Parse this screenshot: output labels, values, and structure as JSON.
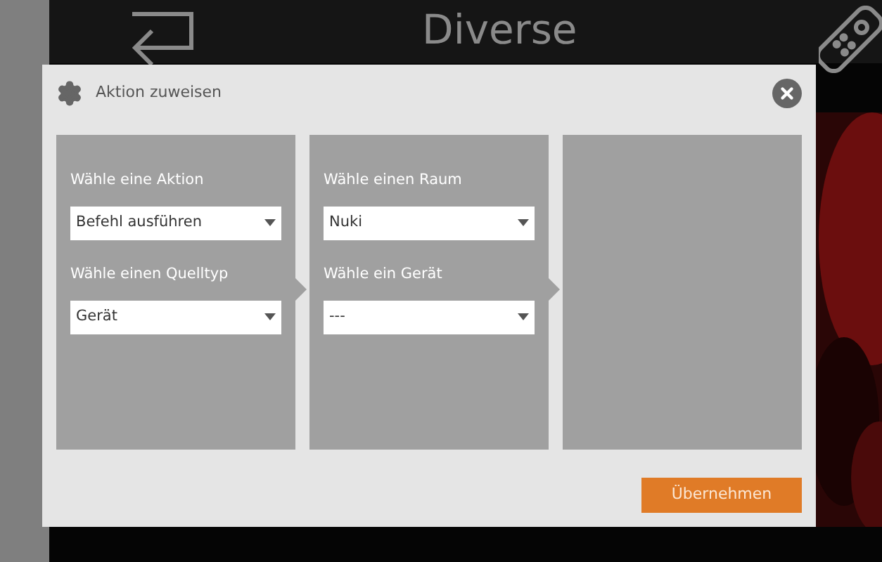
{
  "header": {
    "title": "Diverse"
  },
  "dialog": {
    "title": "Aktion zuweisen",
    "columns": [
      {
        "fields": [
          {
            "label": "Wähle eine Aktion",
            "value": "Befehl ausführen"
          },
          {
            "label": "Wähle einen Quelltyp",
            "value": "Gerät"
          }
        ]
      },
      {
        "fields": [
          {
            "label": "Wähle einen Raum",
            "value": "Nuki"
          },
          {
            "label": "Wähle ein Gerät",
            "value": "---"
          }
        ]
      },
      {}
    ],
    "button": "Übernehmen"
  }
}
